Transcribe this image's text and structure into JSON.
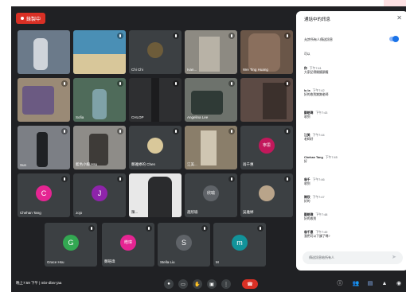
{
  "recording": {
    "label": "錄製中"
  },
  "tiles": [
    {
      "name": ""
    },
    {
      "name": ""
    },
    {
      "name": "Chi Chi"
    },
    {
      "name": "Ivan..."
    },
    {
      "name": "Wei Ting Huang"
    },
    {
      "name": ""
    },
    {
      "name": "Sofia"
    },
    {
      "name": "CHLOP"
    },
    {
      "name": "Angelina Lee"
    },
    {
      "name": ""
    },
    {
      "name": "Sun"
    },
    {
      "name": "藍色小鯨 Hsu"
    },
    {
      "name": "鄭雅婷的 Chen"
    },
    {
      "name": "江美..."
    },
    {
      "name": "翁千惠",
      "initial": "寧思",
      "color": "#c2185b"
    },
    {
      "name": "Chehan Tang",
      "initial": "C",
      "color": "#e52592"
    },
    {
      "name": "Jojo",
      "initial": "J",
      "color": "#8e24aa"
    },
    {
      "name": "陳..."
    },
    {
      "name": "趙欣瑜",
      "initial": "欣瑜",
      "color": "#5f6368"
    },
    {
      "name": "吳雅婷"
    },
    {
      "name": "Grace Hsu",
      "initial": "G",
      "color": "#33a852"
    },
    {
      "name": "鄭皓瑋",
      "initial": "皓瑋",
      "color": "#e52592"
    },
    {
      "name": "Stella Liu",
      "initial": "S",
      "color": "#5f6368"
    },
    {
      "name": "M",
      "initial": "m",
      "color": "#12939a"
    }
  ],
  "chat": {
    "title": "通話中的訊息",
    "toggle_label": "允許所有人傳送訊息",
    "toggle_on": true,
    "messages": [
      {
        "sender": "",
        "time": "",
        "text": "可以"
      },
      {
        "sender": "你",
        "time": "下午7:41",
        "text": "大家記得開鏡頭喔"
      },
      {
        "sender": "Iu la",
        "time": "下午7:42",
        "text": "好的收到謝謝老師"
      },
      {
        "sender": "鄭皓瑋",
        "time": "下午7:43",
        "text": "收到"
      },
      {
        "sender": "江美",
        "time": "下午7:44",
        "text": "老師好"
      },
      {
        "sender": "Chehan Tang",
        "time": "下午7:45",
        "text": "好"
      },
      {
        "sender": "翁千",
        "time": "下午7:46",
        "text": "收到"
      },
      {
        "sender": "陳欣",
        "time": "下午7:47",
        "text": "好的"
      },
      {
        "sender": "鄭皓瑋",
        "time": "下午7:48",
        "text": "好的收到"
      },
      {
        "sender": "翁千惠",
        "time": "下午7:49",
        "text": "我們可以下課了嗎?"
      }
    ],
    "input_placeholder": "傳送訊息給所有人"
  },
  "bottom": {
    "meeting_label": "晚上7:59 下午 | mbr-dbnr-jaa"
  },
  "colors": {
    "accent": "#1a73e8",
    "danger": "#d93025",
    "bg": "#202124"
  }
}
